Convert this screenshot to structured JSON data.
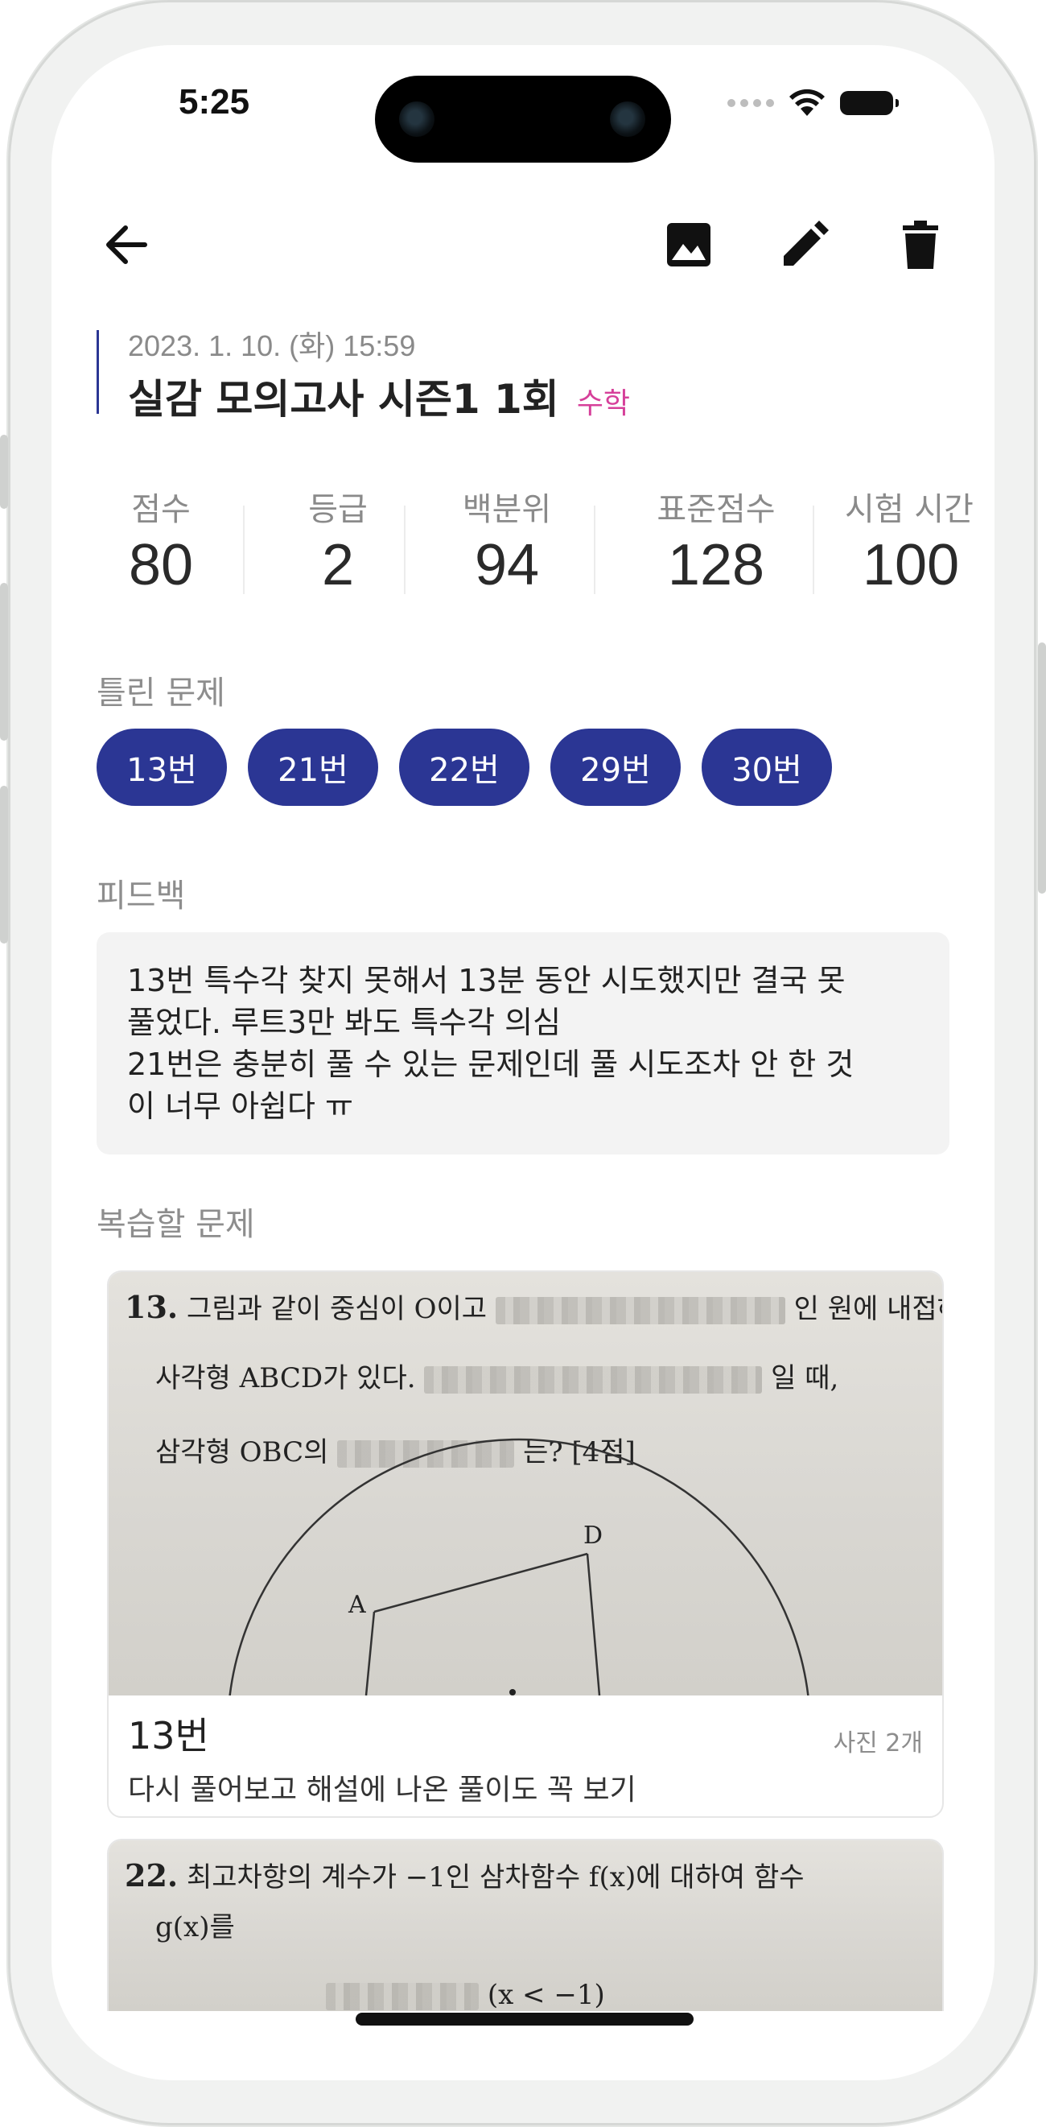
{
  "status_bar": {
    "time": "5:25"
  },
  "toolbar": {
    "back_icon": "arrow-left-icon",
    "image_icon": "image-icon",
    "edit_icon": "pencil-icon",
    "delete_icon": "trash-icon"
  },
  "exam": {
    "date": "2023. 1. 10. (화) 15:59",
    "title": "실감 모의고사 시즌1 1회",
    "subject": "수학"
  },
  "stats": [
    {
      "label": "점수",
      "value": "80"
    },
    {
      "label": "등급",
      "value": "2"
    },
    {
      "label": "백분위",
      "value": "94"
    },
    {
      "label": "표준점수",
      "value": "128"
    },
    {
      "label": "시험 시간",
      "value": "100"
    }
  ],
  "wrong_section": {
    "label": "틀린 문제",
    "items": [
      "13번",
      "21번",
      "22번",
      "29번",
      "30번"
    ]
  },
  "feedback_section": {
    "label": "피드백",
    "lines": [
      "13번 특수각 찾지 못해서 13분 동안 시도했지만 결국 못",
      "풀었다. 루트3만 봐도 특수각 의심",
      "21번은 충분히 풀 수 있는 문제인데 풀 시도조차 안 한 것",
      "이 너무 아쉽다 ㅠ"
    ]
  },
  "review_section": {
    "label": "복습할 문제",
    "cards": [
      {
        "number": "13번",
        "photo_count": "사진 2개",
        "note": "다시 풀어보고 해설에 나온 풀이도 꼭 보기",
        "photo_text": {
          "qnum": "13.",
          "line1a": "그림과 같이 중심이 O이고",
          "line1b": "인 원에 내접하는",
          "line2a": "사각형 ABCD가 있다.",
          "line2b": "일 때,",
          "line3a": "삼각형 OBC의",
          "line3b": "는? [4점]",
          "label_a": "A",
          "label_d": "D"
        }
      },
      {
        "photo_text": {
          "qnum": "22.",
          "line1": "최고차항의 계수가 −1인 삼차함수 f(x)에 대하여 함수",
          "line2": "g(x)를",
          "line3": "(x < −1)"
        }
      }
    ]
  }
}
